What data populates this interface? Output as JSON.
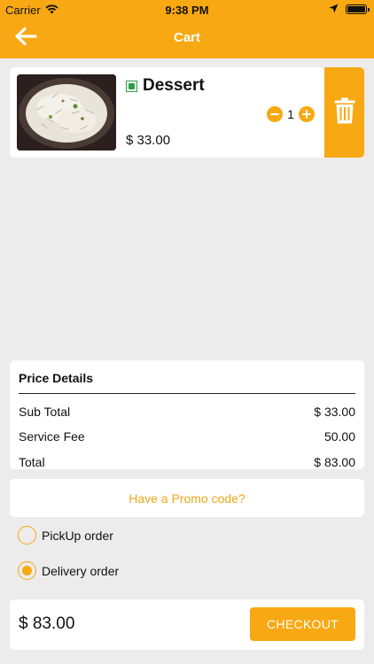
{
  "status_bar": {
    "carrier": "Carrier",
    "time": "9:38 PM"
  },
  "nav": {
    "title": "Cart",
    "back_icon": "arrow-left-icon"
  },
  "cart_item": {
    "name": "Dessert",
    "price": "$ 33.00",
    "quantity": "1",
    "veg_indicator": "veg-icon",
    "delete_icon": "trash-icon"
  },
  "price_details": {
    "title": "Price Details",
    "rows": [
      {
        "label": "Sub Total",
        "value": "$ 33.00"
      },
      {
        "label": "Service Fee",
        "value": "50.00"
      },
      {
        "label": "Total",
        "value": "$ 83.00"
      }
    ]
  },
  "promo": {
    "label": "Have a Promo code?"
  },
  "order_type": {
    "options": [
      {
        "label": "PickUp order",
        "selected": false
      },
      {
        "label": "Delivery order",
        "selected": true
      }
    ]
  },
  "footer": {
    "total": "$ 83.00",
    "checkout_label": "CHECKOUT"
  },
  "colors": {
    "accent": "#f8a813",
    "background": "#ececec",
    "veg_green": "#2e9e4a"
  }
}
